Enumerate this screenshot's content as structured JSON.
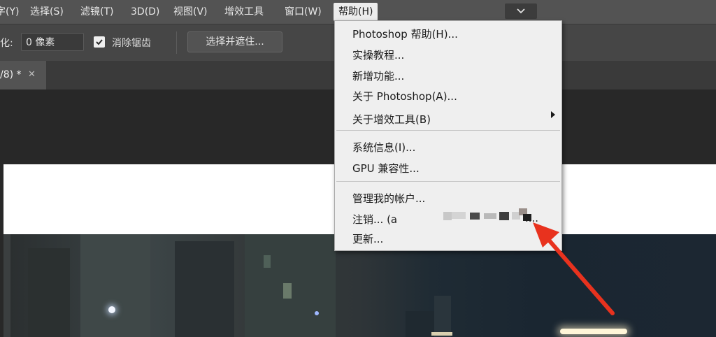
{
  "menubar": {
    "items": [
      {
        "label": "字(Y)"
      },
      {
        "label": "选择(S)"
      },
      {
        "label": "滤镜(T)"
      },
      {
        "label": "3D(D)"
      },
      {
        "label": "视图(V)"
      },
      {
        "label": "增效工具"
      },
      {
        "label": "窗口(W)"
      },
      {
        "label": "帮助(H)"
      }
    ],
    "collapse_icon": "chevron-down-icon"
  },
  "options": {
    "feather_label": "化:",
    "feather_value": "0 像素",
    "antialias_checked": true,
    "antialias_label": "消除锯齿",
    "select_mask_label": "选择并遮住..."
  },
  "tabs": {
    "doc_tab_label": "/8) *",
    "close_icon": "close-icon",
    "close_glyph": "✕"
  },
  "help_menu": {
    "items": [
      {
        "label": "Photoshop 帮助(H)..."
      },
      {
        "label": "实操教程..."
      },
      {
        "label": "新增功能..."
      },
      {
        "label": "关于 Photoshop(A)..."
      },
      {
        "label": "关于增效工具(B)",
        "has_submenu": true
      },
      {
        "label": "系统信息(I)..."
      },
      {
        "label": "GPU 兼容性..."
      },
      {
        "label": "管理我的帐户..."
      },
      {
        "label": "注销... (a"
      },
      {
        "label": "更新..."
      }
    ],
    "account_suffix": "....",
    "submenu_icon": "triangle-right-icon"
  },
  "annotation": {
    "arrow_color": "#e8321e"
  }
}
